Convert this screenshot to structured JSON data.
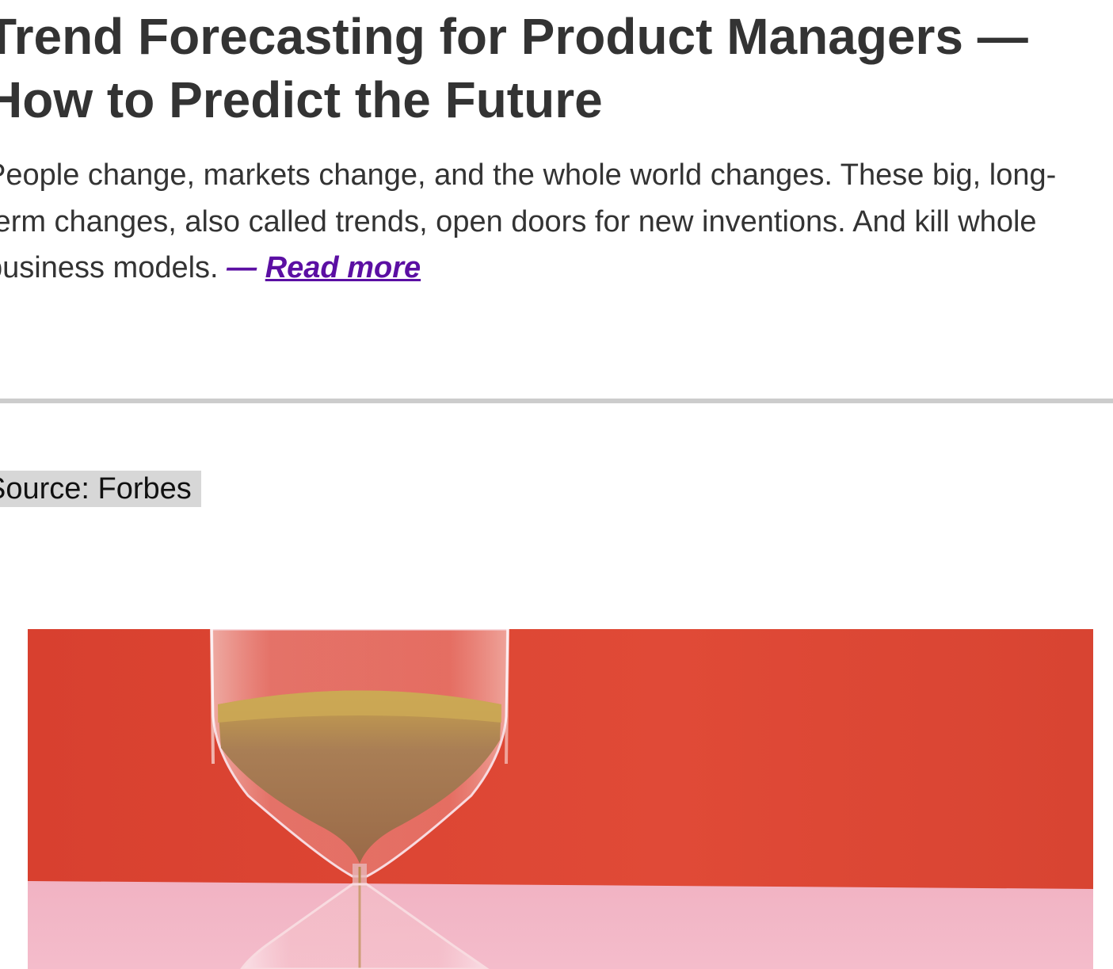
{
  "article": {
    "title_line1": "Trend Forecasting for Product Managers —",
    "title_line2": "How to Predict the Future",
    "summary_line1": "People change, markets change, and the whole world changes. These big, long-",
    "summary_line2": "term changes, also called trends, open doors for new inventions. And kill whole",
    "summary_line3": "business models.",
    "read_more_dash": "—",
    "read_more_label": "Read more"
  },
  "source": {
    "label": "Source: Forbes"
  },
  "image": {
    "subject": "hourglass-photo",
    "colors": {
      "wall": "#d94533",
      "floor": "#f3b9c9",
      "sand": "#b07a4a",
      "sand_top": "#c9a44e"
    }
  },
  "colors": {
    "text": "#333333",
    "link": "#5b0fa3",
    "divider": "#cccccc",
    "source_bg": "#d7d7d7"
  }
}
